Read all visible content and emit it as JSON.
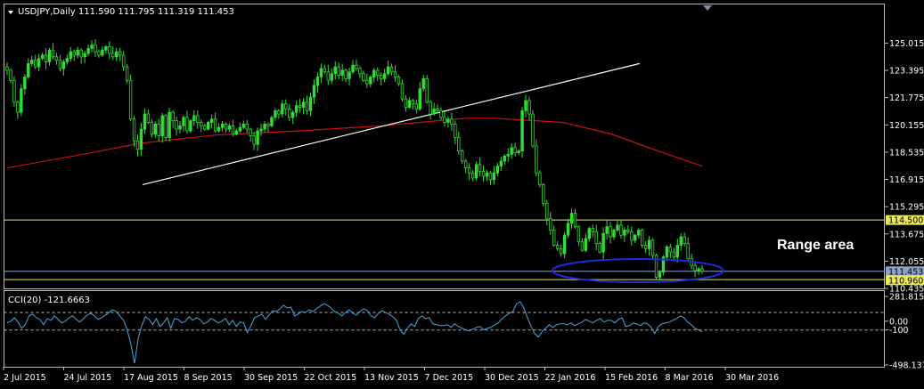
{
  "header": {
    "symbol_line": "USDJPY,Daily  111.590 111.795 111.319 111.453",
    "indicator_line": "CCI(20) -121.6663"
  },
  "annotation": {
    "range_label": "Range area"
  },
  "colors": {
    "background": "#000000",
    "candle": "#33dd33",
    "ma": "#cc1111",
    "trendline": "#ffffff",
    "level_line": "#e8e85a",
    "range_oval": "#1a2ee0",
    "cci": "#4aa6d8",
    "price_line": "#8ea0c8"
  },
  "chart_data": [
    {
      "type": "candlestick",
      "title": "USDJPY,Daily",
      "ohlc_last": {
        "open": 111.59,
        "high": 111.795,
        "low": 111.319,
        "close": 111.453
      },
      "ylim": [
        110.435,
        126.2
      ],
      "yticks": [
        "125.015",
        "123.395",
        "121.775",
        "120.155",
        "118.535",
        "116.915",
        "115.295",
        "113.675",
        "112.055",
        "110.435"
      ],
      "date_labels": [
        "2 Jul 2015",
        "24 Jul 2015",
        "17 Aug 2015",
        "8 Sep 2015",
        "30 Sep 2015",
        "22 Oct 2015",
        "13 Nov 2015",
        "7 Dec 2015",
        "30 Dec 2015",
        "22 Jan 2016",
        "15 Feb 2016",
        "8 Mar 2016",
        "30 Mar 2016"
      ],
      "closes": [
        123.4,
        122.8,
        121.5,
        120.9,
        122.3,
        123.0,
        123.8,
        124.0,
        123.6,
        124.1,
        124.3,
        123.9,
        124.6,
        124.2,
        124.0,
        123.5,
        123.9,
        124.1,
        124.5,
        124.3,
        124.6,
        124.2,
        124.4,
        124.7,
        124.9,
        124.5,
        124.3,
        124.6,
        124.8,
        124.4,
        124.2,
        124.5,
        124.3,
        123.6,
        122.8,
        120.5,
        119.2,
        118.7,
        119.9,
        120.8,
        120.3,
        119.6,
        120.2,
        119.5,
        120.7,
        119.4,
        120.9,
        120.4,
        119.9,
        120.1,
        120.6,
        119.8,
        120.4,
        120.7,
        120.3,
        120.1,
        119.9,
        120.3,
        120.5,
        119.8,
        120.0,
        120.2,
        119.9,
        120.1,
        119.6,
        119.8,
        120.0,
        120.2,
        119.9,
        119.5,
        119.0,
        119.8,
        119.9,
        120.2,
        120.1,
        120.6,
        121.0,
        120.8,
        121.4,
        121.1,
        120.6,
        120.9,
        121.3,
        121.2,
        121.5,
        121.0,
        121.8,
        122.5,
        123.0,
        123.5,
        123.3,
        122.8,
        123.2,
        123.6,
        123.1,
        123.4,
        122.9,
        123.3,
        123.7,
        123.5,
        123.2,
        122.8,
        122.6,
        123.0,
        123.4,
        123.1,
        122.9,
        123.2,
        123.6,
        123.3,
        123.0,
        122.6,
        121.7,
        121.2,
        121.6,
        121.4,
        121.1,
        122.3,
        122.9,
        121.5,
        120.8,
        121.1,
        121.0,
        120.6,
        120.3,
        120.5,
        120.2,
        119.4,
        118.6,
        118.0,
        117.6,
        117.3,
        117.0,
        117.8,
        117.4,
        117.1,
        117.3,
        116.9,
        117.3,
        117.7,
        118.0,
        118.3,
        118.4,
        118.8,
        118.5,
        118.6,
        121.0,
        121.6,
        120.8,
        118.9,
        117.3,
        116.6,
        115.5,
        114.6,
        113.9,
        113.0,
        112.8,
        112.5,
        113.6,
        114.3,
        114.9,
        114.1,
        113.2,
        112.7,
        113.4,
        114.0,
        113.8,
        113.1,
        112.6,
        113.7,
        114.1,
        113.5,
        113.9,
        114.2,
        113.6,
        113.9,
        113.8,
        113.3,
        113.6,
        113.9,
        113.0,
        112.8,
        113.3,
        112.4,
        111.1,
        111.4,
        112.3,
        112.9,
        112.6,
        112.3,
        113.0,
        113.5,
        113.1,
        112.2,
        111.8,
        111.5,
        111.6,
        111.45
      ],
      "ma_200": [
        {
          "x": 0,
          "y": 117.6
        },
        {
          "x": 0.095,
          "y": 118.3
        },
        {
          "x": 0.19,
          "y": 119.05
        },
        {
          "x": 0.3,
          "y": 119.55
        },
        {
          "x": 0.42,
          "y": 119.8
        },
        {
          "x": 0.54,
          "y": 120.1
        },
        {
          "x": 0.62,
          "y": 120.4
        },
        {
          "x": 0.66,
          "y": 120.55
        },
        {
          "x": 0.7,
          "y": 120.55
        },
        {
          "x": 0.8,
          "y": 120.3
        },
        {
          "x": 0.87,
          "y": 119.6
        },
        {
          "x": 0.93,
          "y": 118.7
        },
        {
          "x": 1.0,
          "y": 117.7
        }
      ],
      "trendline": {
        "from": {
          "x": 0.195,
          "y": 116.6
        },
        "to": {
          "x": 0.91,
          "y": 123.8
        }
      },
      "horizontal_levels": [
        114.5,
        110.96
      ],
      "current_price_line": 111.453,
      "level_labels": [
        "114.500",
        "111.453",
        "110.960"
      ],
      "annotation": "Range area"
    },
    {
      "type": "line",
      "title": "CCI(20) -121.6663",
      "ylim": [
        -498.1371,
        281.8159
      ],
      "yticks": [
        "281.8159",
        "0.00",
        "-100",
        "-498.1371"
      ],
      "levels": [
        100,
        -100
      ],
      "values": [
        -20,
        0,
        40,
        -10,
        -80,
        -40,
        60,
        80,
        40,
        20,
        -40,
        30,
        10,
        60,
        20,
        -20,
        0,
        40,
        60,
        20,
        -10,
        30,
        70,
        90,
        60,
        20,
        40,
        70,
        100,
        130,
        110,
        60,
        10,
        -100,
        -260,
        -480,
        -200,
        -50,
        50,
        20,
        -40,
        30,
        -60,
        -20,
        40,
        -80,
        30,
        20,
        -20,
        0,
        50,
        10,
        40,
        20,
        -30,
        -10,
        30,
        10,
        -20,
        0,
        30,
        -40,
        10,
        -60,
        -10,
        -20,
        -130,
        -50,
        40,
        60,
        80,
        20,
        70,
        120,
        110,
        140,
        180,
        150,
        160,
        60,
        80,
        110,
        100,
        130,
        110,
        140,
        170,
        200,
        180,
        150,
        110,
        90,
        60,
        100,
        130,
        90,
        70,
        110,
        140,
        120,
        60,
        40,
        90,
        120,
        100,
        80,
        50,
        10,
        -100,
        -150,
        -80,
        -30,
        -60,
        30,
        60,
        30,
        40,
        -30,
        -40,
        -50,
        -50,
        -40,
        -70,
        -30,
        -60,
        -80,
        -100,
        -110,
        -90,
        -70,
        -60,
        -100,
        -80,
        -70,
        -40,
        -20,
        30,
        60,
        90,
        110,
        200,
        220,
        150,
        40,
        -60,
        -140,
        -180,
        -120,
        -80,
        -40,
        -70,
        -40,
        -30,
        -30,
        -40,
        -20,
        -50,
        -30,
        -10,
        20,
        0,
        -20,
        10,
        30,
        -10,
        10,
        10,
        -20,
        20,
        40,
        -60,
        -50,
        -20,
        -30,
        -50,
        -20,
        -30,
        -70,
        -140,
        -60,
        -30,
        -20,
        -10,
        10,
        30,
        60,
        40,
        -10,
        -40,
        -80,
        -100,
        -121.7
      ]
    }
  ]
}
